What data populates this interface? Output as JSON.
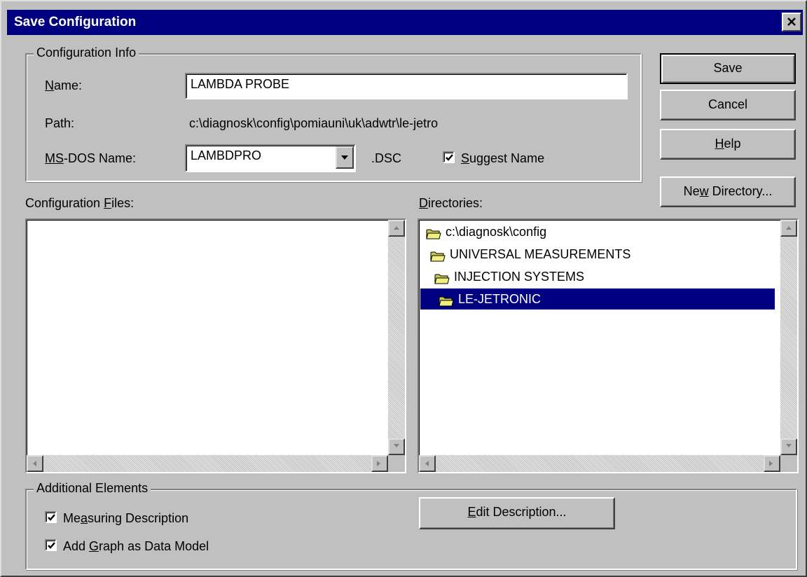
{
  "window": {
    "title": "Save Configuration",
    "close_glyph": "✕"
  },
  "config_info": {
    "title": "Configuration Info",
    "name_label": "Name:",
    "name_value": "LAMBDA PROBE",
    "path_label": "Path:",
    "path_value": "c:\\diagnosk\\config\\pomiauni\\uk\\adwtr\\le-jetro",
    "msdos_label": "MS-DOS Name:",
    "msdos_value": "LAMBDPRO",
    "ext_label": ".DSC",
    "suggest_label": "Suggest Name",
    "suggest_checked": true
  },
  "buttons": {
    "save": "Save",
    "cancel": "Cancel",
    "help": "Help",
    "new_directory": "New Directory...",
    "edit_description": "Edit Description..."
  },
  "config_files": {
    "label": "Configuration Files:",
    "items": []
  },
  "directories": {
    "label": "Directories:",
    "items": [
      {
        "label": "c:\\diagnosk\\config",
        "selected": false
      },
      {
        "label": "UNIVERSAL MEASUREMENTS",
        "selected": false
      },
      {
        "label": "INJECTION SYSTEMS",
        "selected": false
      },
      {
        "label": "LE-JETRONIC",
        "selected": true
      }
    ]
  },
  "additional": {
    "title": "Additional Elements",
    "measuring_label": "Measuring Description",
    "measuring_checked": true,
    "graph_label": "Add Graph as Data Model",
    "graph_checked": true
  },
  "colors": {
    "title_bar": "#000080",
    "face": "#c0c0c0",
    "selection": "#000080"
  }
}
